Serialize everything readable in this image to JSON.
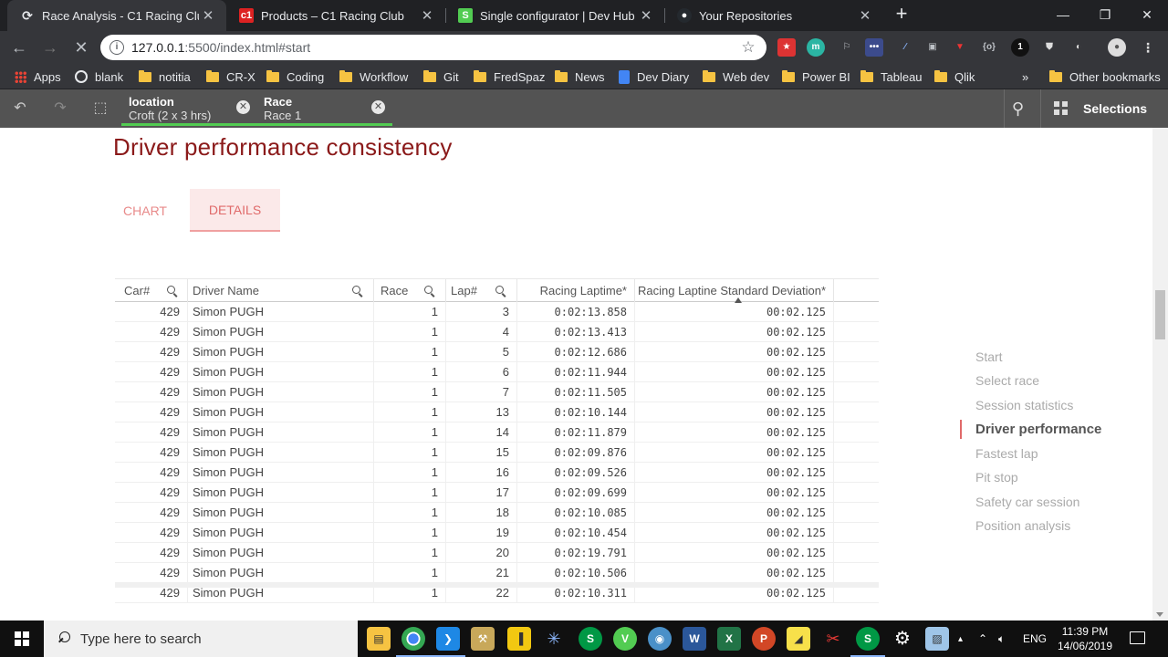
{
  "browser": {
    "tabs": [
      {
        "title": "Race Analysis - C1 Racing Club",
        "favicon": "loading-icon",
        "active": true
      },
      {
        "title": "Products – C1 Racing Club",
        "favicon": "c1-logo-icon",
        "active": false
      },
      {
        "title": "Single configurator | Dev Hub",
        "favicon": "qlik-sense-icon",
        "active": false
      },
      {
        "title": "Your Repositories",
        "favicon": "github-icon",
        "active": false
      }
    ],
    "address": {
      "host": "127.0.0.1",
      "rest": ":5500/index.html#start"
    },
    "bookmarks": [
      {
        "label": "Apps",
        "icon": "apps-icon"
      },
      {
        "label": "blank",
        "icon": "globe-icon"
      },
      {
        "label": "notitia",
        "icon": "folder-icon"
      },
      {
        "label": "CR-X",
        "icon": "folder-icon"
      },
      {
        "label": "Coding",
        "icon": "folder-icon"
      },
      {
        "label": "Workflow",
        "icon": "folder-icon"
      },
      {
        "label": "Git",
        "icon": "folder-icon"
      },
      {
        "label": "FredSpaz",
        "icon": "folder-icon"
      },
      {
        "label": "News",
        "icon": "folder-icon"
      },
      {
        "label": "Dev Diary",
        "icon": "doc-icon"
      },
      {
        "label": "Web dev",
        "icon": "folder-icon"
      },
      {
        "label": "Power BI",
        "icon": "folder-icon"
      },
      {
        "label": "Tableau",
        "icon": "folder-icon"
      },
      {
        "label": "Qlik",
        "icon": "folder-icon"
      }
    ],
    "bookmarks_overflow": "»",
    "other_bookmarks": "Other bookmarks"
  },
  "toolbar": {
    "chips": [
      {
        "title": "location",
        "value": "Croft (2 x 3 hrs)"
      },
      {
        "title": "Race",
        "value": "Race 1"
      }
    ],
    "selections_label": "Selections"
  },
  "page": {
    "title": "Driver performance consistency",
    "tabs": [
      {
        "label": "CHART",
        "active": false
      },
      {
        "label": "DETAILS",
        "active": true
      }
    ]
  },
  "table": {
    "columns": [
      "Car#",
      "Driver Name",
      "Race",
      "Lap#",
      "Racing Laptime*",
      "Racing Laptine Standard Deviation*"
    ],
    "rows": [
      [
        "429",
        "Simon PUGH",
        "1",
        "3",
        "0:02:13.858",
        "00:02.125"
      ],
      [
        "429",
        "Simon PUGH",
        "1",
        "4",
        "0:02:13.413",
        "00:02.125"
      ],
      [
        "429",
        "Simon PUGH",
        "1",
        "5",
        "0:02:12.686",
        "00:02.125"
      ],
      [
        "429",
        "Simon PUGH",
        "1",
        "6",
        "0:02:11.944",
        "00:02.125"
      ],
      [
        "429",
        "Simon PUGH",
        "1",
        "7",
        "0:02:11.505",
        "00:02.125"
      ],
      [
        "429",
        "Simon PUGH",
        "1",
        "13",
        "0:02:10.144",
        "00:02.125"
      ],
      [
        "429",
        "Simon PUGH",
        "1",
        "14",
        "0:02:11.879",
        "00:02.125"
      ],
      [
        "429",
        "Simon PUGH",
        "1",
        "15",
        "0:02:09.876",
        "00:02.125"
      ],
      [
        "429",
        "Simon PUGH",
        "1",
        "16",
        "0:02:09.526",
        "00:02.125"
      ],
      [
        "429",
        "Simon PUGH",
        "1",
        "17",
        "0:02:09.699",
        "00:02.125"
      ],
      [
        "429",
        "Simon PUGH",
        "1",
        "18",
        "0:02:10.085",
        "00:02.125"
      ],
      [
        "429",
        "Simon PUGH",
        "1",
        "19",
        "0:02:10.454",
        "00:02.125"
      ],
      [
        "429",
        "Simon PUGH",
        "1",
        "20",
        "0:02:19.791",
        "00:02.125"
      ],
      [
        "429",
        "Simon PUGH",
        "1",
        "21",
        "0:02:10.506",
        "00:02.125"
      ],
      [
        "429",
        "Simon PUGH",
        "1",
        "22",
        "0:02:10.311",
        "00:02.125"
      ]
    ]
  },
  "right_nav": {
    "items": [
      "Start",
      "Select race",
      "Session statistics",
      "Driver performance",
      "Fastest lap",
      "Pit stop",
      "Safety car session",
      "Position analysis"
    ],
    "active_index": 3
  },
  "taskbar": {
    "search_placeholder": "Type here to search",
    "language": "ENG",
    "time": "11:39 PM",
    "date": "14/06/2019"
  },
  "colors": {
    "title": "#8b1a1a",
    "tab_accent": "#e06a6a",
    "chip_underline": "#52cc52",
    "toolbar_bg": "#535353"
  }
}
